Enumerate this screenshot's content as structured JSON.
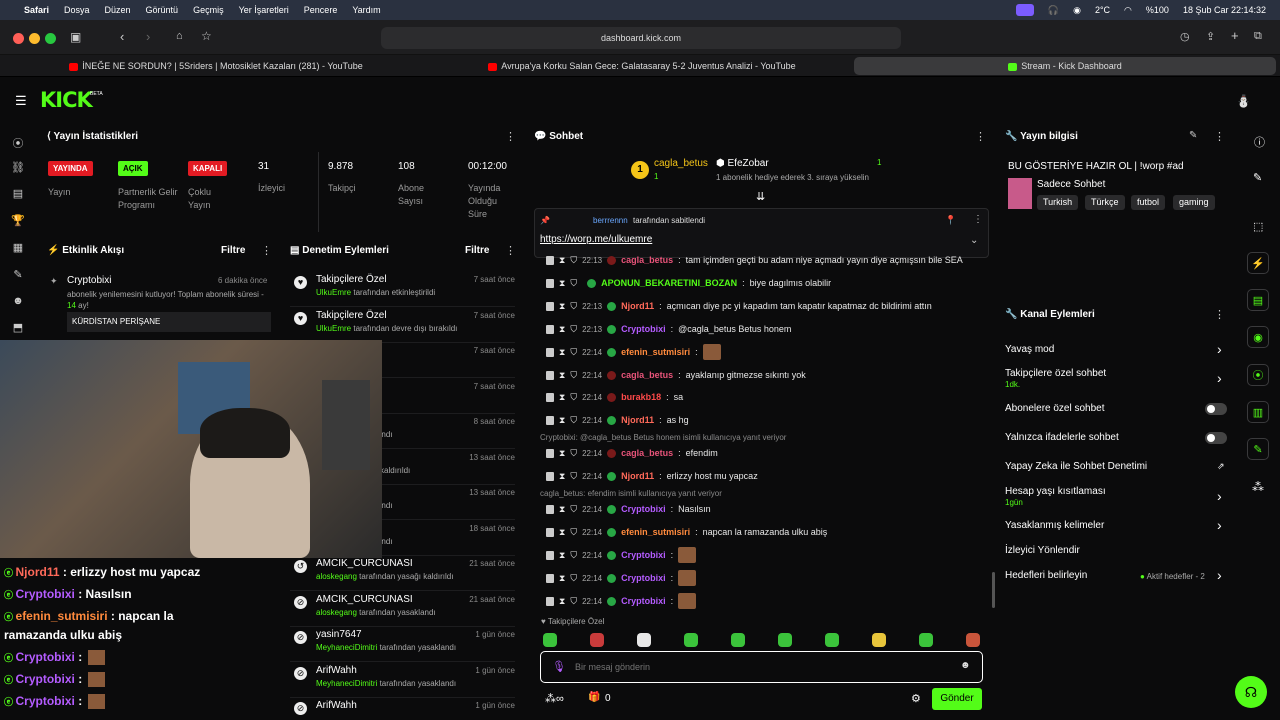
{
  "menubar": {
    "apple": "",
    "app": "Safari",
    "items": [
      "Dosya",
      "Düzen",
      "Görüntü",
      "Geçmiş",
      "Yer İşaretleri",
      "Pencere",
      "Yardım"
    ],
    "temp": "2°C",
    "battery": "%100",
    "datetime": "18 Şub Car  22:14:32"
  },
  "browser": {
    "url": "dashboard.kick.com",
    "tabs": [
      {
        "label": "İNEĞE NE SORDUN? | 5Sriders | Motosiklet Kazaları (281) - YouTube",
        "color": "#ff0000"
      },
      {
        "label": "Avrupa'ya Korku Salan Gece: Galatasaray 5-2 Juventus Analizi - YouTube",
        "color": "#ff0000"
      },
      {
        "label": "Stream - Kick Dashboard",
        "color": "#53fc18"
      }
    ]
  },
  "kick": {
    "logo": "KICK",
    "beta": "BETA"
  },
  "stats": {
    "title": "Yayın İstatistikleri",
    "badges": [
      {
        "text": "YAYINDA",
        "label": "Yayın",
        "bg": "#e31b23",
        "fg": "#fff"
      },
      {
        "text": "AÇIK",
        "label": "Partnerlik Gelir Programı",
        "bg": "#53fc18",
        "fg": "#000"
      },
      {
        "text": "KAPALI",
        "label": "Çoklu Yayın",
        "bg": "#e31b23",
        "fg": "#fff"
      }
    ],
    "viewers_val": "31",
    "viewers_lbl": "İzleyici",
    "followers_val": "9.878",
    "followers_lbl": "Takipçi",
    "subs_val": "108",
    "subs_lbl": "Abone Sayısı",
    "uptime_val": "00:12:00",
    "uptime_lbl": "Yayında Olduğu Süre"
  },
  "activity": {
    "title": "Etkinlik Akışı",
    "filter": "Filtre",
    "item_user": "Cryptobixi",
    "item_time": "6 dakika önce",
    "item_text_a": "abonelik yenilemesini kutluyor! Toplam abonelik süresi - ",
    "item_text_b": "14",
    "item_text_c": " ay!",
    "item_msg": "KÜRDİSTAN PERİŞANE"
  },
  "mod": {
    "title": "Denetim Eylemleri",
    "filter": "Filtre",
    "rows": [
      {
        "title": "Takipçilere Özel",
        "user": "UlkuEmre",
        "rest": " tarafından etkinleştirildi",
        "time": "7 saat önce",
        "icon": "heart"
      },
      {
        "title": "Takipçilere Özel",
        "user": "UlkuEmre",
        "rest": " tarafından devre dışı bırakıldı",
        "time": "7 saat önce",
        "icon": "heart"
      },
      {
        "title": "",
        "user": "",
        "rest": "ından etkinleştirildi",
        "time": "7 saat önce",
        "icon": ""
      },
      {
        "title": "el",
        "user": "",
        "rest": "ından etkinleştirildi",
        "time": "7 saat önce",
        "icon": ""
      },
      {
        "title": "",
        "user": "",
        "rest": "tarafından yasaklandı",
        "time": "8 saat önce",
        "icon": ""
      },
      {
        "title": "",
        "user": "",
        "rest": "tarafından yasağı kaldırıldı",
        "time": "13 saat önce",
        "icon": ""
      },
      {
        "title": "",
        "user": "",
        "rest": "tarafından yasaklandı",
        "time": "13 saat önce",
        "icon": ""
      },
      {
        "title": "miste",
        "user": "",
        "rest": "tarafından yasaklandı",
        "time": "18 saat önce",
        "icon": ""
      },
      {
        "title": "AMCIK_CURCUNASI",
        "user": "aloskegang",
        "rest": " tarafından yasağı kaldırıldı",
        "time": "21 saat önce",
        "icon": "undo"
      },
      {
        "title": "AMCIK_CURCUNASI",
        "user": "aloskegang",
        "rest": " tarafından yasaklandı",
        "time": "21 saat önce",
        "icon": "ban"
      },
      {
        "title": "yasin7647",
        "user": "MeyhaneciDimitri",
        "rest": " tarafından yasaklandı",
        "time": "1 gün önce",
        "icon": "ban"
      },
      {
        "title": "ArifWahh",
        "user": "MeyhaneciDimitri",
        "rest": " tarafından yasaklandı",
        "time": "1 gün önce",
        "icon": "ban"
      },
      {
        "title": "ArifWahh",
        "user": "",
        "rest": "",
        "time": "1 gün önce",
        "icon": "ban"
      }
    ]
  },
  "chat": {
    "title": "Sohbet",
    "gift_user": "cagla_betus",
    "gift_count": "1",
    "gift_rank": "1",
    "target": "EfeZobar",
    "target_count": "1",
    "gift_text": "1 abonelik hediye ederek 3. sıraya yükselin",
    "pin_by": "berrrennn",
    "pin_suffix": " tarafından sabitlendi",
    "pin_link": "https://worp.me/ulkuemre",
    "messages": [
      {
        "time": "22:13",
        "user": "cagla_betus",
        "color": "#e8547a",
        "text": "tam içimden geçti bu adam niye açmadı yayın diye açmışsın bile SEA"
      },
      {
        "time": "",
        "user": "APONUN_BEKARETINI_BOZAN",
        "color": "#53fc18",
        "text": "biye dagılmıs olabilir"
      },
      {
        "time": "22:13",
        "user": "Njord11",
        "color": "#ff6a5a",
        "text": "açmıcan diye pc yi kapadım tam kapatır kapatmaz dc bildirimi attın"
      },
      {
        "time": "22:13",
        "user": "Cryptobixi",
        "color": "#b45cff",
        "text": "@cagla_betus Betus honem"
      },
      {
        "time": "22:14",
        "user": "efenin_sutmisiri",
        "color": "#ff8a3d",
        "text": ""
      },
      {
        "time": "22:14",
        "user": "cagla_betus",
        "color": "#e8547a",
        "text": "ayaklanıp gitmezse sıkıntı yok"
      },
      {
        "time": "22:14",
        "user": "burakb18",
        "color": "#ff4a4a",
        "text": "sa"
      },
      {
        "time": "22:14",
        "user": "Njord11",
        "color": "#ff6a5a",
        "text": "as hg"
      },
      {
        "time": "22:14",
        "user": "cagla_betus",
        "color": "#e8547a",
        "text": "efendim"
      },
      {
        "time": "22:14",
        "user": "Njord11",
        "color": "#ff6a5a",
        "text": "erlizzy host mu yapcaz"
      },
      {
        "time": "22:14",
        "user": "Cryptobixi",
        "color": "#b45cff",
        "text": "Nasılsın"
      },
      {
        "time": "22:14",
        "user": "efenin_sutmisiri",
        "color": "#ff8a3d",
        "text": "napcan la ramazanda ulku abiş"
      },
      {
        "time": "22:14",
        "user": "Cryptobixi",
        "color": "#b45cff",
        "text": ""
      },
      {
        "time": "22:14",
        "user": "Cryptobixi",
        "color": "#b45cff",
        "text": ""
      },
      {
        "time": "22:14",
        "user": "Cryptobixi",
        "color": "#b45cff",
        "text": ""
      }
    ],
    "reply1": "Cryptobixi: @cagla_betus Betus honem isimli kullanıcıya yanıt veriyor",
    "reply2": "cagla_betus: efendim isimli kullanıcıya yanıt veriyor",
    "followers_only": "Takipçilere Özel",
    "placeholder": "Bir mesaj gönderin",
    "send": "Gönder",
    "count": "0"
  },
  "info": {
    "title": "Yayın bilgisi",
    "stream_title": "BU GÖSTERİYE HAZIR OL | !worp #ad",
    "category": "Sadece Sohbet",
    "tags": [
      "Turkish",
      "Türkçe",
      "futbol",
      "gaming"
    ]
  },
  "channel": {
    "title": "Kanal Eylemleri",
    "slow": "Yavaş mod",
    "followers": "Takipçilere özel sohbet",
    "followers_sub": "1dk.",
    "subs": "Abonelere özel sohbet",
    "emotes": "Yalnızca ifadelerle sohbet",
    "ai": "Yapay Zeka ile Sohbet Denetimi",
    "age": "Hesap yaşı kısıtlaması",
    "age_sub": "1gün",
    "banned": "Yasaklanmış kelimeler",
    "redirect": "İzleyici Yönlendir",
    "goals": "Hedefleri belirleyin",
    "goals_sub": "Aktif hedefler - 2"
  },
  "overlay": [
    {
      "user": "Njord11",
      "color": "#ff6a5a",
      "text": " : erlizzy host mu yapcaz"
    },
    {
      "user": "Cryptobixi",
      "color": "#b45cff",
      "text": " : Nasılsın"
    },
    {
      "user": "efenin_sutmisiri",
      "color": "#ff8a3d",
      "text": " : napcan la"
    },
    {
      "user": "",
      "color": "#fff",
      "text": "ramazanda ulku abiş"
    },
    {
      "user": "Cryptobixi",
      "color": "#b45cff",
      "text": " :"
    },
    {
      "user": "Cryptobixi",
      "color": "#b45cff",
      "text": " :"
    },
    {
      "user": "Cryptobixi",
      "color": "#b45cff",
      "text": " :"
    }
  ]
}
